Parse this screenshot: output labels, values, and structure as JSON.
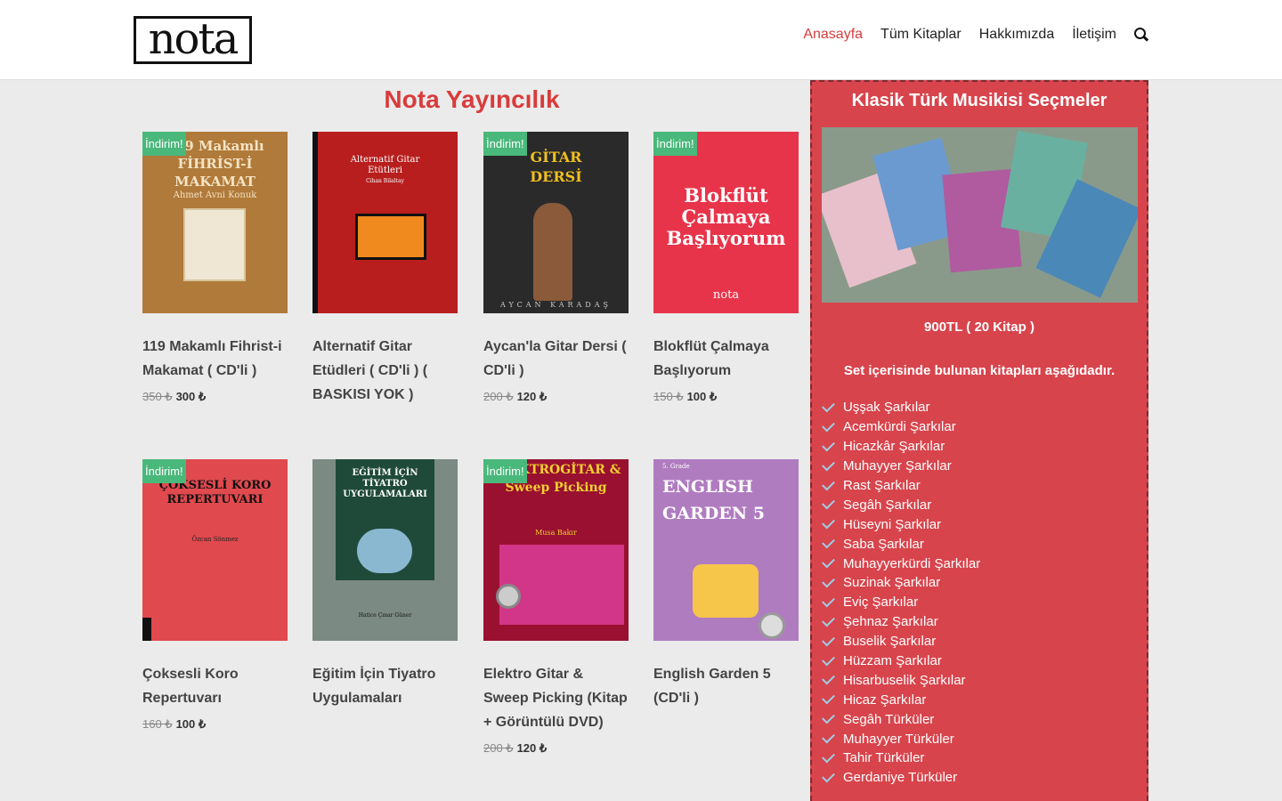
{
  "header": {
    "logo_text": "nota",
    "nav": [
      "Anasayfa",
      "Tüm Kitaplar",
      "Hakkımızda",
      "İletişim"
    ],
    "search_icon": "search-icon"
  },
  "page_title": "Nota Yayıncılık",
  "sale_label": "İndirim!",
  "products": [
    {
      "title": "119 Makamlı Fihrist-i Makamat ( CD'li )",
      "old_price": "350 ₺",
      "price": "300 ₺",
      "sale": true,
      "cover_text": "119 Makamlı FİHRİST-İ MAKAMAT",
      "cover_sub": "Ahmet Avni Konuk"
    },
    {
      "title": "Alternatif Gitar Etüdleri ( CD'li ) ( BASKISI YOK )",
      "old_price": "",
      "price": "",
      "sale": false,
      "cover_text": "Alternatif Gitar Etütleri",
      "cover_sub": "Cihan Bilaltay"
    },
    {
      "title": "Aycan'la Gitar Dersi ( CD'li )",
      "old_price": "200 ₺",
      "price": "120 ₺",
      "sale": true,
      "cover_text": "GİTAR DERSİ",
      "cover_sub": "AYCAN KARADAŞ"
    },
    {
      "title": "Blokflüt Çalmaya Başlıyorum",
      "old_price": "150 ₺",
      "price": "100 ₺",
      "sale": true,
      "cover_text": "Blokflüt Çalmaya Başlıyorum",
      "cover_sub": "nota"
    },
    {
      "title": "Çoksesli Koro Repertuvarı",
      "old_price": "160 ₺",
      "price": "100 ₺",
      "sale": true,
      "cover_text": "ÇOKSESLİ KORO REPERTUVARI",
      "cover_sub": "Özcan Sönmez"
    },
    {
      "title": "Eğitim İçin Tiyatro Uygulamaları",
      "old_price": "",
      "price": "",
      "sale": false,
      "cover_text": "EĞİTİM İÇİN TİYATRO UYGULAMALARI",
      "cover_sub": "Hatice Çınar Güner"
    },
    {
      "title": "Elektro Gitar & Sweep Picking (Kitap + Görüntülü DVD)",
      "old_price": "200 ₺",
      "price": "120 ₺",
      "sale": true,
      "cover_text": "ELEKTROGİTAR & Sweep Picking",
      "cover_sub": "Musa Bakır"
    },
    {
      "title": "English Garden 5 (CD'li )",
      "old_price": "",
      "price": "",
      "sale": false,
      "cover_text": "ENGLISH GARDEN 5",
      "cover_sub": "5. Grade"
    }
  ],
  "sidebar": {
    "title": "Klasik Türk Musikisi Seçmeler",
    "price": "900TL ( 20 Kitap )",
    "note": "Set içerisinde bulunan kitapları aşağıdadır.",
    "items": [
      "Uşşak Şarkılar",
      "Acemkürdi Şarkılar",
      "Hicazkâr Şarkılar",
      "Muhayyer Şarkılar",
      "Rast Şarkılar",
      "Segâh Şarkılar",
      "Hüseyni Şarkılar",
      "Saba Şarkılar",
      "Muhayyerkürdi Şarkılar",
      "Suzinak Şarkılar",
      "Eviç Şarkılar",
      "Şehnaz Şarkılar",
      "Buselik Şarkılar",
      "Hüzzam Şarkılar",
      "Hisarbuselik Şarkılar",
      "Hicaz Şarkılar",
      "Segâh Türküler",
      "Muhayyer Türküler",
      "Tahir Türküler",
      "Gerdaniye Türküler"
    ]
  },
  "colors": {
    "accent": "#d93b3b",
    "badge": "#49b87a",
    "sidebar": "#d8444c"
  }
}
